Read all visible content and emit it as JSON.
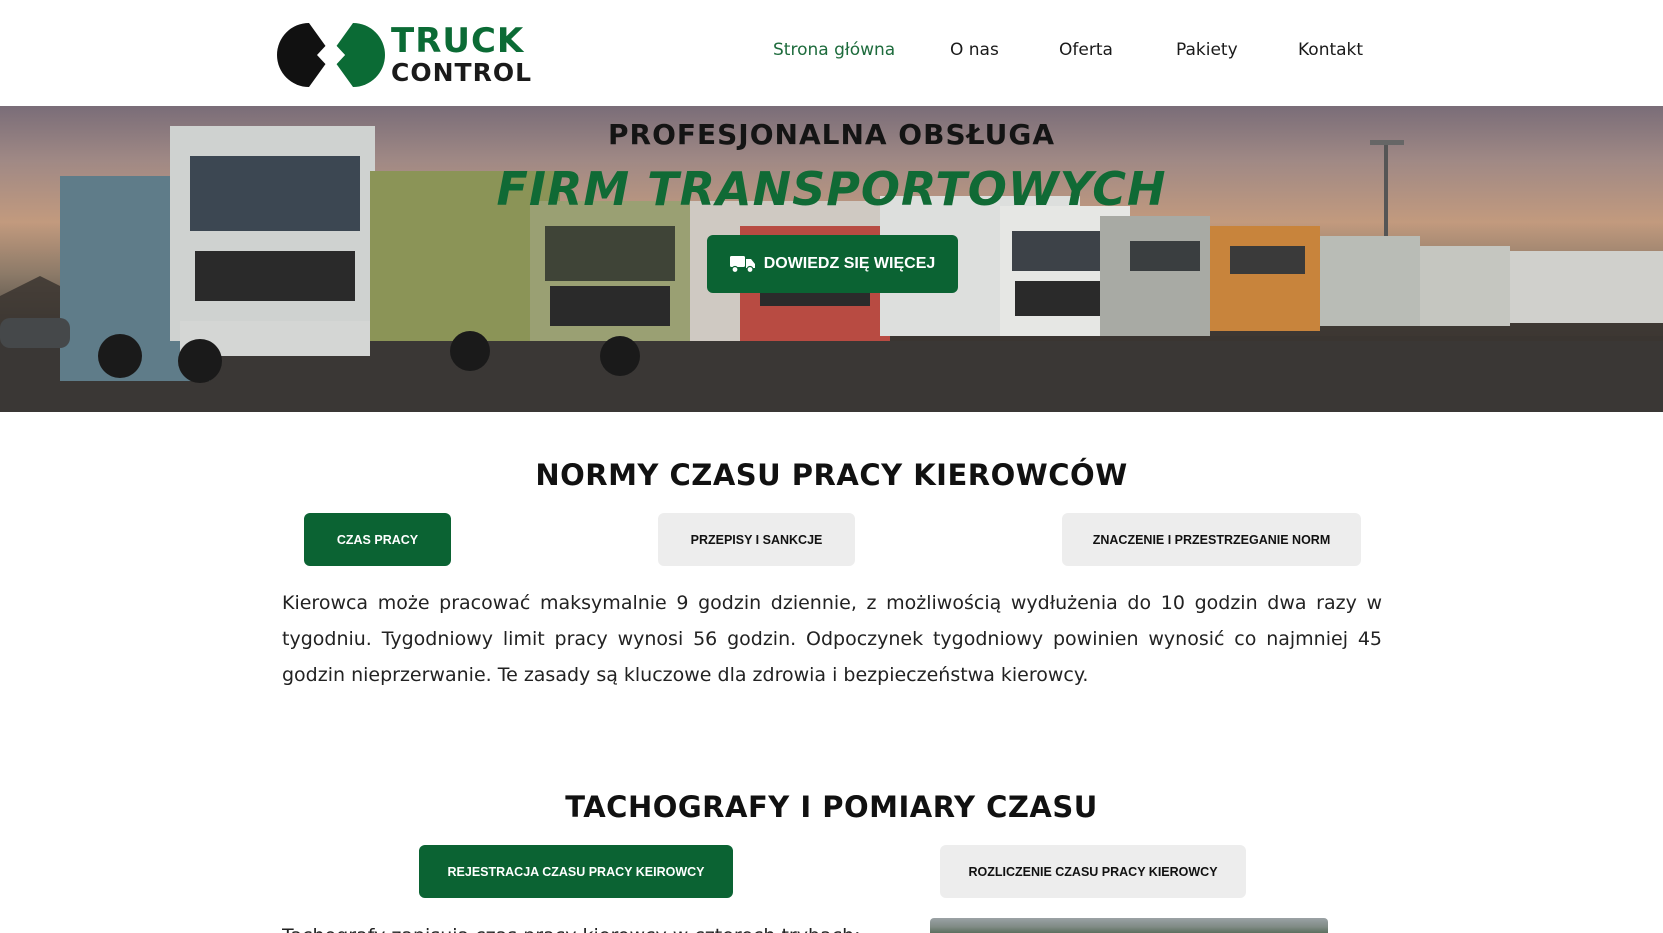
{
  "brand": {
    "logo_line1": "TRUCK",
    "logo_line2": "CONTROL",
    "colors": {
      "green": "#0b6333",
      "dark": "#1a1a1a"
    }
  },
  "nav": {
    "items": [
      {
        "label": "Strona główna",
        "active": true
      },
      {
        "label": "O nas",
        "active": false
      },
      {
        "label": "Oferta",
        "active": false
      },
      {
        "label": "Pakiety",
        "active": false
      },
      {
        "label": "Kontakt",
        "active": false
      }
    ]
  },
  "hero": {
    "title": "PROFESJONALNA OBSŁUGA",
    "subtitle": "FIRM TRANSPORTOWYCH",
    "cta_label": "DOWIEDZ SIĘ WIĘCEJ",
    "cta_icon": "truck-icon"
  },
  "section1": {
    "title": "NORMY CZASU PRACY KIEROWCÓW",
    "tabs": [
      {
        "label": "CZAS PRACY",
        "active": true
      },
      {
        "label": "PRZEPISY I SANKCJE",
        "active": false
      },
      {
        "label": "ZNACZENIE I PRZESTRZEGANIE NORM",
        "active": false
      }
    ],
    "paragraph": "Kierowca może pracować maksymalnie 9 godzin dziennie, z możliwością wydłużenia do 10 godzin dwa razy w tygodniu. Tygodniowy limit pracy wynosi 56 godzin. Odpoczynek tygodniowy powinien wynosić co najmniej 45 godzin nieprzerwanie. Te zasady są kluczowe dla zdrowia i bezpieczeństwa kierowcy."
  },
  "section2": {
    "title": "TACHOGRAFY I POMIARY CZASU",
    "tabs": [
      {
        "label": "REJESTRACJA CZASU PRACY KEIROWCY",
        "active": true
      },
      {
        "label": "ROZLICZENIE CZASU PRACY KIEROWCY",
        "active": false
      }
    ],
    "paragraph_start": "Tachografy zapisują czas pracy kierowcy w czterech trybach: jazdy"
  }
}
